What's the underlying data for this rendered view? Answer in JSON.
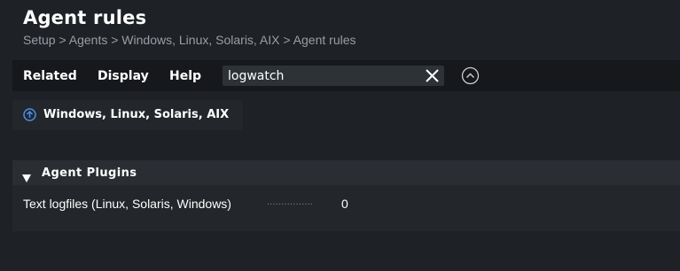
{
  "header": {
    "title": "Agent rules",
    "breadcrumb": "Setup > Agents > Windows, Linux, Solaris, AIX > Agent rules"
  },
  "menubar": {
    "items": [
      "Related",
      "Display",
      "Help"
    ],
    "search_value": "logwatch",
    "clear_icon": "close-icon",
    "collapse_icon": "chevron-up-circle-icon"
  },
  "folder": {
    "icon": "arrow-up-circle-icon",
    "label": "Windows, Linux, Solaris, AIX"
  },
  "section": {
    "title": "Agent Plugins",
    "rules": [
      {
        "label": "Text logfiles (Linux, Solaris, Windows)",
        "dots": "................",
        "count": "0"
      }
    ]
  },
  "colors": {
    "background": "#1e2125",
    "panel": "#23272c",
    "accent": "#4a8fe7",
    "muted_text": "#9a9ea4"
  }
}
